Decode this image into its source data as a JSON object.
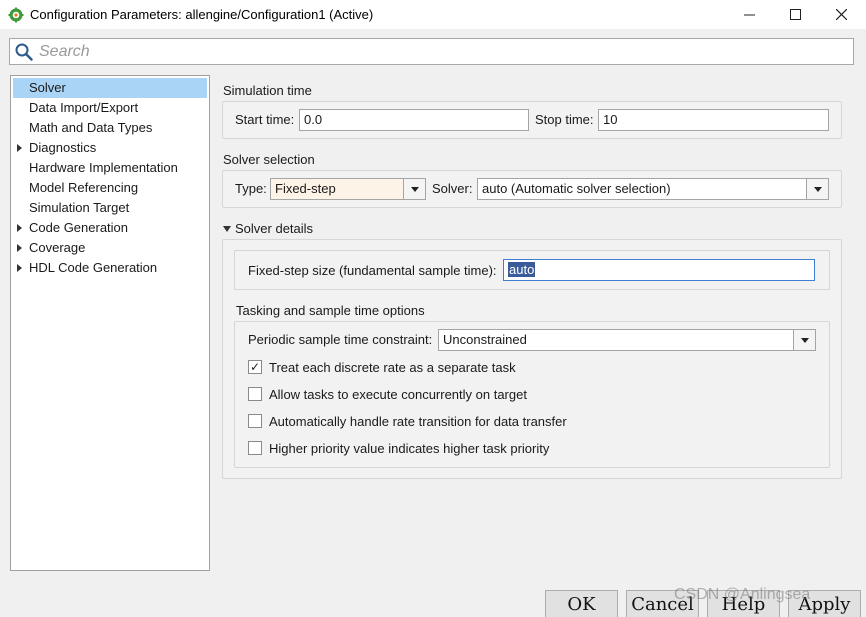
{
  "window": {
    "title": "Configuration Parameters: allengine/Configuration1 (Active)",
    "minimize_glyph": "—",
    "maximize_glyph": "☐",
    "close_glyph": "✕"
  },
  "search": {
    "placeholder": "Search"
  },
  "tree": {
    "items": [
      {
        "label": "Solver",
        "expandable": false,
        "selected": true
      },
      {
        "label": "Data Import/Export",
        "expandable": false
      },
      {
        "label": "Math and Data Types",
        "expandable": false
      },
      {
        "label": "Diagnostics",
        "expandable": true
      },
      {
        "label": "Hardware Implementation",
        "expandable": false
      },
      {
        "label": "Model Referencing",
        "expandable": false
      },
      {
        "label": "Simulation Target",
        "expandable": false
      },
      {
        "label": "Code Generation",
        "expandable": true
      },
      {
        "label": "Coverage",
        "expandable": true
      },
      {
        "label": "HDL Code Generation",
        "expandable": true
      }
    ]
  },
  "simulation_time": {
    "title": "Simulation time",
    "start_label": "Start time:",
    "start_value": "0.0",
    "stop_label": "Stop time:",
    "stop_value": "10"
  },
  "solver_selection": {
    "title": "Solver selection",
    "type_label": "Type:",
    "type_value": "Fixed-step",
    "solver_label": "Solver:",
    "solver_value": "auto (Automatic solver selection)"
  },
  "solver_details": {
    "title": "Solver details",
    "step_size_label": "Fixed-step size (fundamental sample time):",
    "step_size_value": "auto"
  },
  "tasking": {
    "title": "Tasking and sample time options",
    "constraint_label": "Periodic sample time constraint:",
    "constraint_value": "Unconstrained",
    "checkboxes": [
      {
        "label": "Treat each discrete rate as a separate task",
        "checked": true
      },
      {
        "label": "Allow tasks to execute concurrently on target",
        "checked": false
      },
      {
        "label": "Automatically handle rate transition for data transfer",
        "checked": false
      },
      {
        "label": "Higher priority value indicates higher task priority",
        "checked": false
      }
    ]
  },
  "buttons": {
    "ok": "OK",
    "cancel": "Cancel",
    "help": "Help",
    "apply": "Apply"
  },
  "watermark": "CSDN @Anlingsea",
  "colors": {
    "selected_bg": "#a9d4f5",
    "type_combo_bg": "#fdf3e7",
    "selection_highlight": "#3a5b9a"
  }
}
